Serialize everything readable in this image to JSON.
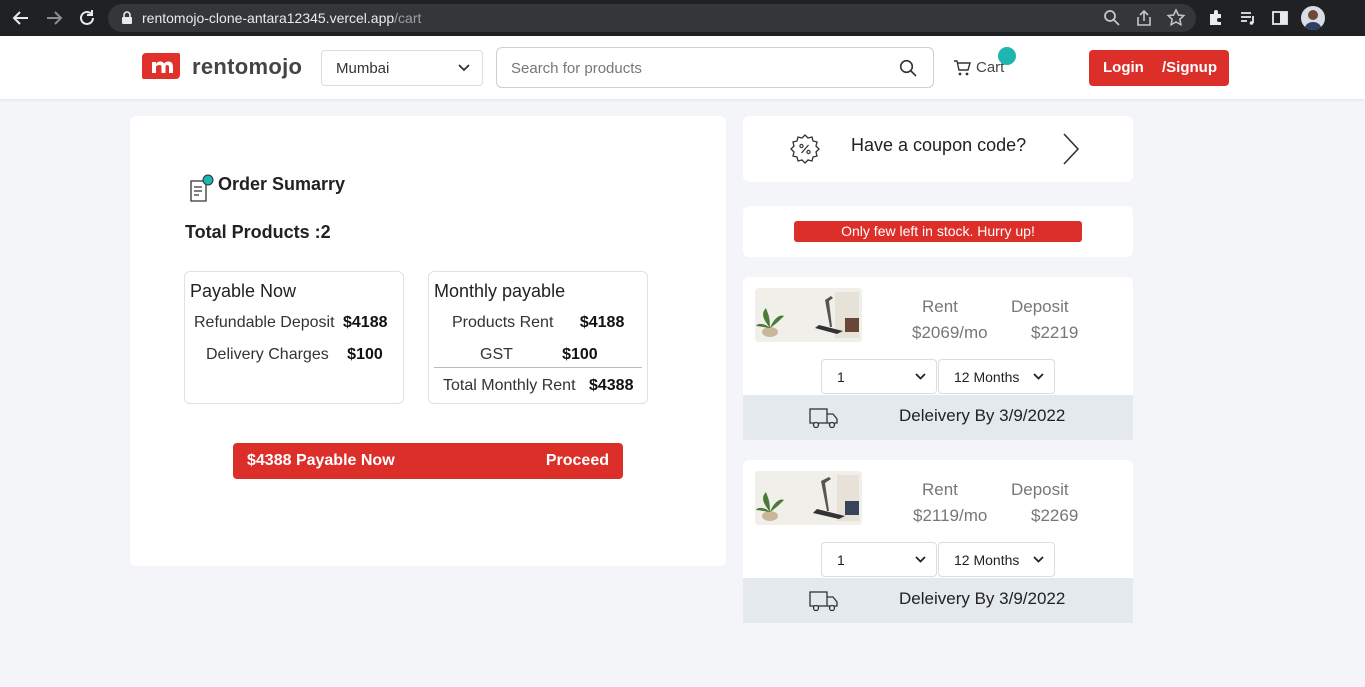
{
  "browser": {
    "url_host": "rentomojo-clone-antara12345.vercel.app",
    "url_path": "/cart"
  },
  "header": {
    "logo_text": "rentomojo",
    "city": "Mumbai",
    "search_placeholder": "Search for products",
    "cart_label": "Cart",
    "login_label": "Login",
    "signup_label": "/Signup"
  },
  "summary": {
    "title": "Order Sumarry",
    "total_products": "Total Products :2",
    "payable_now": {
      "heading": "Payable Now",
      "refundable_label": "Refundable Deposit",
      "refundable_value": "$4188",
      "delivery_label": "Delivery Charges",
      "delivery_value": "$100"
    },
    "monthly": {
      "heading": "Monthly payable",
      "products_rent_label": "Products Rent",
      "products_rent_value": "$4188",
      "gst_label": "GST",
      "gst_value": "$100",
      "total_label": "Total Monthly Rent",
      "total_value": "$4388"
    },
    "pay_button_left": "$4388 Payable Now",
    "pay_button_right": "Proceed"
  },
  "coupon": {
    "text": "Have a coupon code?"
  },
  "stock_notice": "Only few left in stock. Hurry up!",
  "products": [
    {
      "rent_label": "Rent",
      "rent_value": "$2069/mo",
      "deposit_label": "Deposit",
      "deposit_value": "$2219",
      "quantity": "1",
      "tenure": "12 Months",
      "delivery_text": "Deleivery By 3/9/2022"
    },
    {
      "rent_label": "Rent",
      "rent_value": "$2119/mo",
      "deposit_label": "Deposit",
      "deposit_value": "$2269",
      "quantity": "1",
      "tenure": "12 Months",
      "delivery_text": "Deleivery By 3/9/2022"
    }
  ],
  "colors": {
    "brand_red": "#dc2f2a",
    "accent_teal": "#1fb5b1",
    "delivery_bg": "#e4e9ee"
  }
}
